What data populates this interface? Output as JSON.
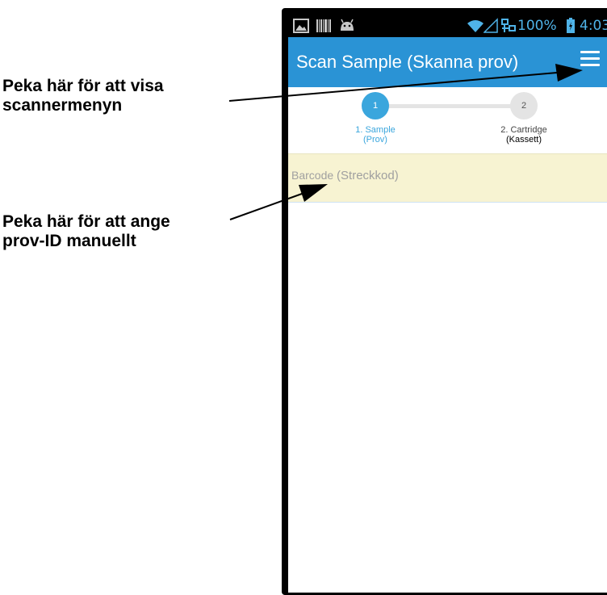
{
  "callouts": {
    "menu": [
      "Peka här för att visa",
      "scannermenyn"
    ],
    "manual_id": [
      "Peka här för att ange",
      "prov-ID manuellt"
    ]
  },
  "status_bar": {
    "battery_percent": "100%",
    "time": "4:03",
    "icons": [
      "image-icon",
      "barcode-icon",
      "android-icon",
      "wifi-icon",
      "signal-icon",
      "network-icon",
      "battery-icon"
    ]
  },
  "app_bar": {
    "title": "Scan Sample",
    "title_translation": "(Skanna prov)",
    "menu_icon": "hamburger-menu-icon"
  },
  "stepper": {
    "steps": [
      {
        "number": "1",
        "label": "1. Sample",
        "translation": "(Prov)",
        "active": true
      },
      {
        "number": "2",
        "label": "2. Cartridge",
        "translation": "(Kassett)",
        "active": false
      }
    ]
  },
  "barcode": {
    "placeholder": "Barcode",
    "placeholder_translation": "(Streckkod)"
  },
  "colors": {
    "app_bar": "#2a93d5",
    "step_active": "#3aa6dd",
    "step_inactive": "#e4e4e4",
    "barcode_row": "#f7f3d2"
  }
}
